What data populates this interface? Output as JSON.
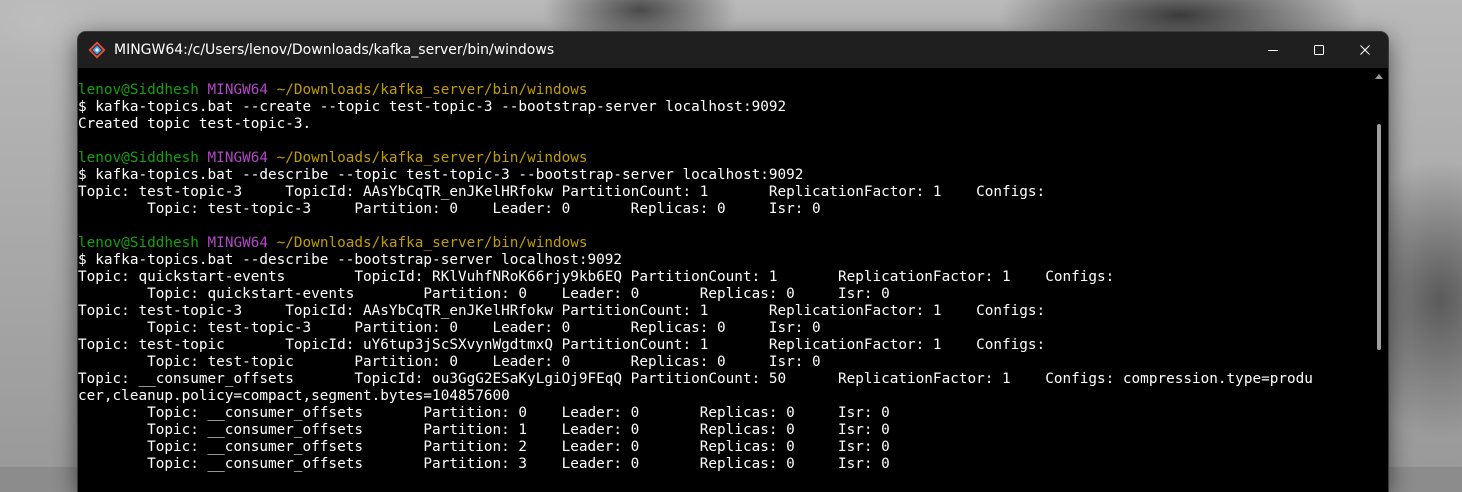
{
  "window": {
    "title": "MINGW64:/c/Users/lenov/Downloads/kafka_server/bin/windows",
    "app_icon": "git-bash-icon",
    "controls": [
      "minimize-icon",
      "maximize-icon",
      "close-icon"
    ]
  },
  "colors": {
    "prompt_user": "#13a10e",
    "prompt_shell": "#b148c6",
    "prompt_path": "#c19c00",
    "text": "#ffffff",
    "background": "#000000"
  },
  "terminal": {
    "prompt": {
      "user_host": "lenov@Siddhesh",
      "shell": "MINGW64",
      "path": "~/Downloads/kafka_server/bin/windows"
    },
    "lines": [
      {
        "kind": "prompt"
      },
      {
        "kind": "text",
        "text": "$ kafka-topics.bat --create --topic test-topic-3 --bootstrap-server localhost:9092"
      },
      {
        "kind": "text",
        "text": "Created topic test-topic-3."
      },
      {
        "kind": "blank"
      },
      {
        "kind": "prompt"
      },
      {
        "kind": "text",
        "text": "$ kafka-topics.bat --describe --topic test-topic-3 --bootstrap-server localhost:9092"
      },
      {
        "kind": "text",
        "text": "Topic: test-topic-3     TopicId: AAsYbCqTR_enJKelHRfokw PartitionCount: 1       ReplicationFactor: 1    Configs:"
      },
      {
        "kind": "text",
        "text": "        Topic: test-topic-3     Partition: 0    Leader: 0       Replicas: 0     Isr: 0"
      },
      {
        "kind": "blank"
      },
      {
        "kind": "prompt"
      },
      {
        "kind": "text",
        "text": "$ kafka-topics.bat --describe --bootstrap-server localhost:9092"
      },
      {
        "kind": "text",
        "text": "Topic: quickstart-events        TopicId: RKlVuhfNRoK66rjy9kb6EQ PartitionCount: 1       ReplicationFactor: 1    Configs:"
      },
      {
        "kind": "text",
        "text": "        Topic: quickstart-events        Partition: 0    Leader: 0       Replicas: 0     Isr: 0"
      },
      {
        "kind": "text",
        "text": "Topic: test-topic-3     TopicId: AAsYbCqTR_enJKelHRfokw PartitionCount: 1       ReplicationFactor: 1    Configs:"
      },
      {
        "kind": "text",
        "text": "        Topic: test-topic-3     Partition: 0    Leader: 0       Replicas: 0     Isr: 0"
      },
      {
        "kind": "text",
        "text": "Topic: test-topic       TopicId: uY6tup3jScSXvynWgdtmxQ PartitionCount: 1       ReplicationFactor: 1    Configs:"
      },
      {
        "kind": "text",
        "text": "        Topic: test-topic       Partition: 0    Leader: 0       Replicas: 0     Isr: 0"
      },
      {
        "kind": "text",
        "text": "Topic: __consumer_offsets       TopicId: ou3GgG2ESaKyLgiOj9FEqQ PartitionCount: 50      ReplicationFactor: 1    Configs: compression.type=produ"
      },
      {
        "kind": "text",
        "text": "cer,cleanup.policy=compact,segment.bytes=104857600"
      },
      {
        "kind": "text",
        "text": "        Topic: __consumer_offsets       Partition: 0    Leader: 0       Replicas: 0     Isr: 0"
      },
      {
        "kind": "text",
        "text": "        Topic: __consumer_offsets       Partition: 1    Leader: 0       Replicas: 0     Isr: 0"
      },
      {
        "kind": "text",
        "text": "        Topic: __consumer_offsets       Partition: 2    Leader: 0       Replicas: 0     Isr: 0"
      },
      {
        "kind": "text",
        "text": "        Topic: __consumer_offsets       Partition: 3    Leader: 0       Replicas: 0     Isr: 0"
      }
    ]
  }
}
